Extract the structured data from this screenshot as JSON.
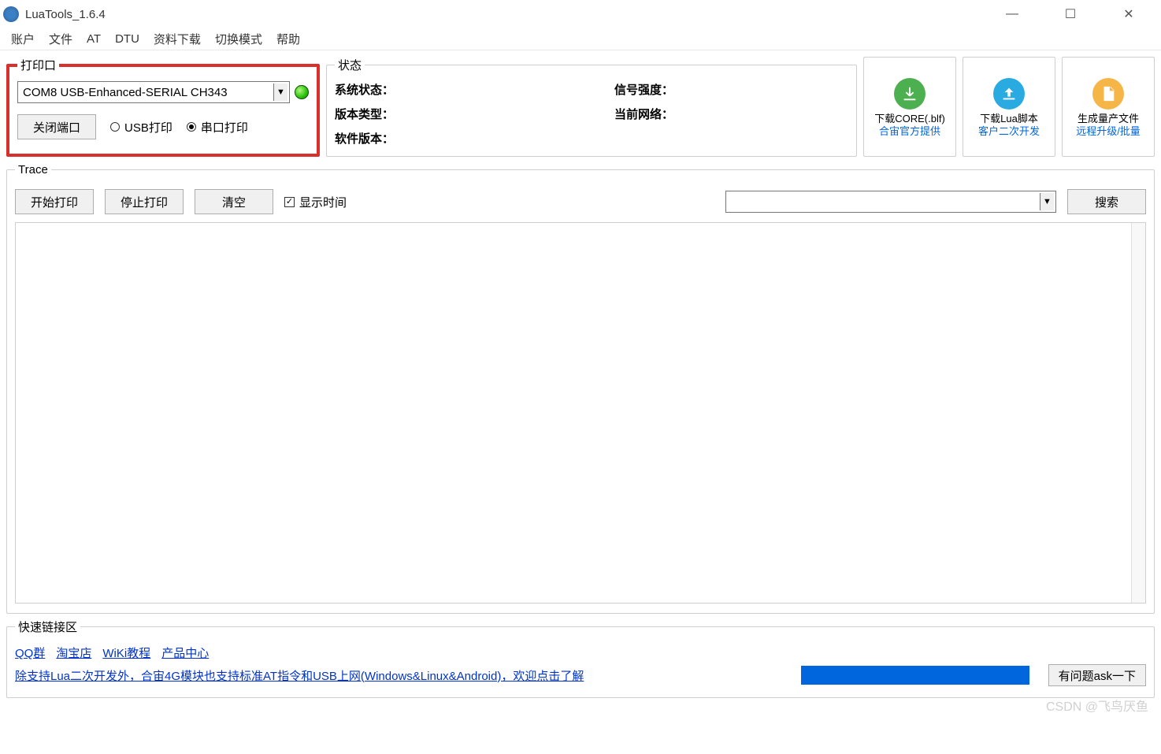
{
  "window": {
    "title": "LuaTools_1.6.4"
  },
  "menu": [
    "账户",
    "文件",
    "AT",
    "DTU",
    "资料下载",
    "切换模式",
    "帮助"
  ],
  "print_group": {
    "legend": "打印口",
    "port_value": "COM8 USB-Enhanced-SERIAL CH343",
    "close_btn": "关闭端口",
    "radio_usb": "USB打印",
    "radio_serial": "串口打印"
  },
  "status_group": {
    "legend": "状态",
    "sys_status": "系统状态：",
    "ver_type": "版本类型：",
    "sw_ver": "软件版本：",
    "signal": "信号强度：",
    "network": "当前网络："
  },
  "cards": [
    {
      "line1": "下载CORE(.blf)",
      "line2": "合宙官方提供",
      "color": "green",
      "glyph": "↓"
    },
    {
      "line1": "下载Lua脚本",
      "line2": "客户二次开发",
      "color": "blue",
      "glyph": "⬆"
    },
    {
      "line1": "生成量产文件",
      "line2": "远程升级/批量",
      "color": "orange",
      "glyph": "📄"
    }
  ],
  "trace": {
    "legend": "Trace",
    "start": "开始打印",
    "stop": "停止打印",
    "clear": "清空",
    "show_time": "显示时间",
    "search_btn": "搜索",
    "search_value": ""
  },
  "quicklinks": {
    "legend": "快速链接区",
    "links": [
      "QQ群",
      "淘宝店",
      "WiKi教程",
      "产品中心"
    ],
    "long_link": "除支持Lua二次开发外，合宙4G模块也支持标准AT指令和USB上网(Windows&Linux&Android)，欢迎点击了解",
    "ask_btn": "有问题ask一下"
  },
  "watermark": "CSDN @飞鸟厌鱼"
}
